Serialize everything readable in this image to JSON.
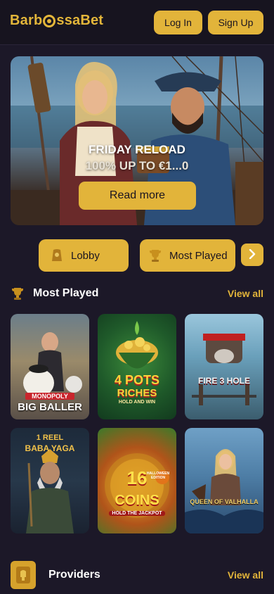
{
  "header": {
    "logo": "BarbossaBet",
    "logo_parts": [
      "Barb",
      "ssaBet"
    ],
    "login_label": "Log In",
    "signup_label": "Sign Up"
  },
  "banner": {
    "title": "FRIDAY RELOAD",
    "subtitle": "100% UP TO €1...0",
    "cta_label": "Read more"
  },
  "nav_tabs": [
    {
      "label": "Lobby",
      "icon": "lobby-icon"
    },
    {
      "label": "Most Played",
      "icon": "trophy-icon"
    }
  ],
  "next_icon": "chevron-right-icon",
  "most_played": {
    "title": "Most Played",
    "icon": "trophy-icon",
    "view_all": "View all",
    "games": [
      {
        "name": "MONOPOLY BIG BALLER",
        "label_top": "MONOPOLY",
        "label_main": "BIG BALLER"
      },
      {
        "name": "4 POTS RICHES",
        "label_top": "4 POTS",
        "label_main": "RICHES",
        "label_sub": "HOLD AND WIN"
      },
      {
        "name": "FIRE 3 HOLE",
        "label_main": "FIRE 3 HOLE"
      },
      {
        "name": "1 REEL BABA YAGA",
        "label_top": "1 REEL",
        "label_main": "BABA YAGA"
      },
      {
        "name": "16 COINS",
        "label_top": "16",
        "label_main": "COINS",
        "label_sub": "HOLD THE JACKPOT",
        "badge": "HALLOWEEN EDITION"
      },
      {
        "name": "QUEEN OF VALHALLA",
        "label_main": "QUEEN OF VALHALLA"
      }
    ]
  },
  "providers": {
    "title": "Providers",
    "view_all": "View all"
  },
  "colors": {
    "accent": "#e2b43a",
    "background": "#1c1828",
    "header": "#17141f"
  }
}
